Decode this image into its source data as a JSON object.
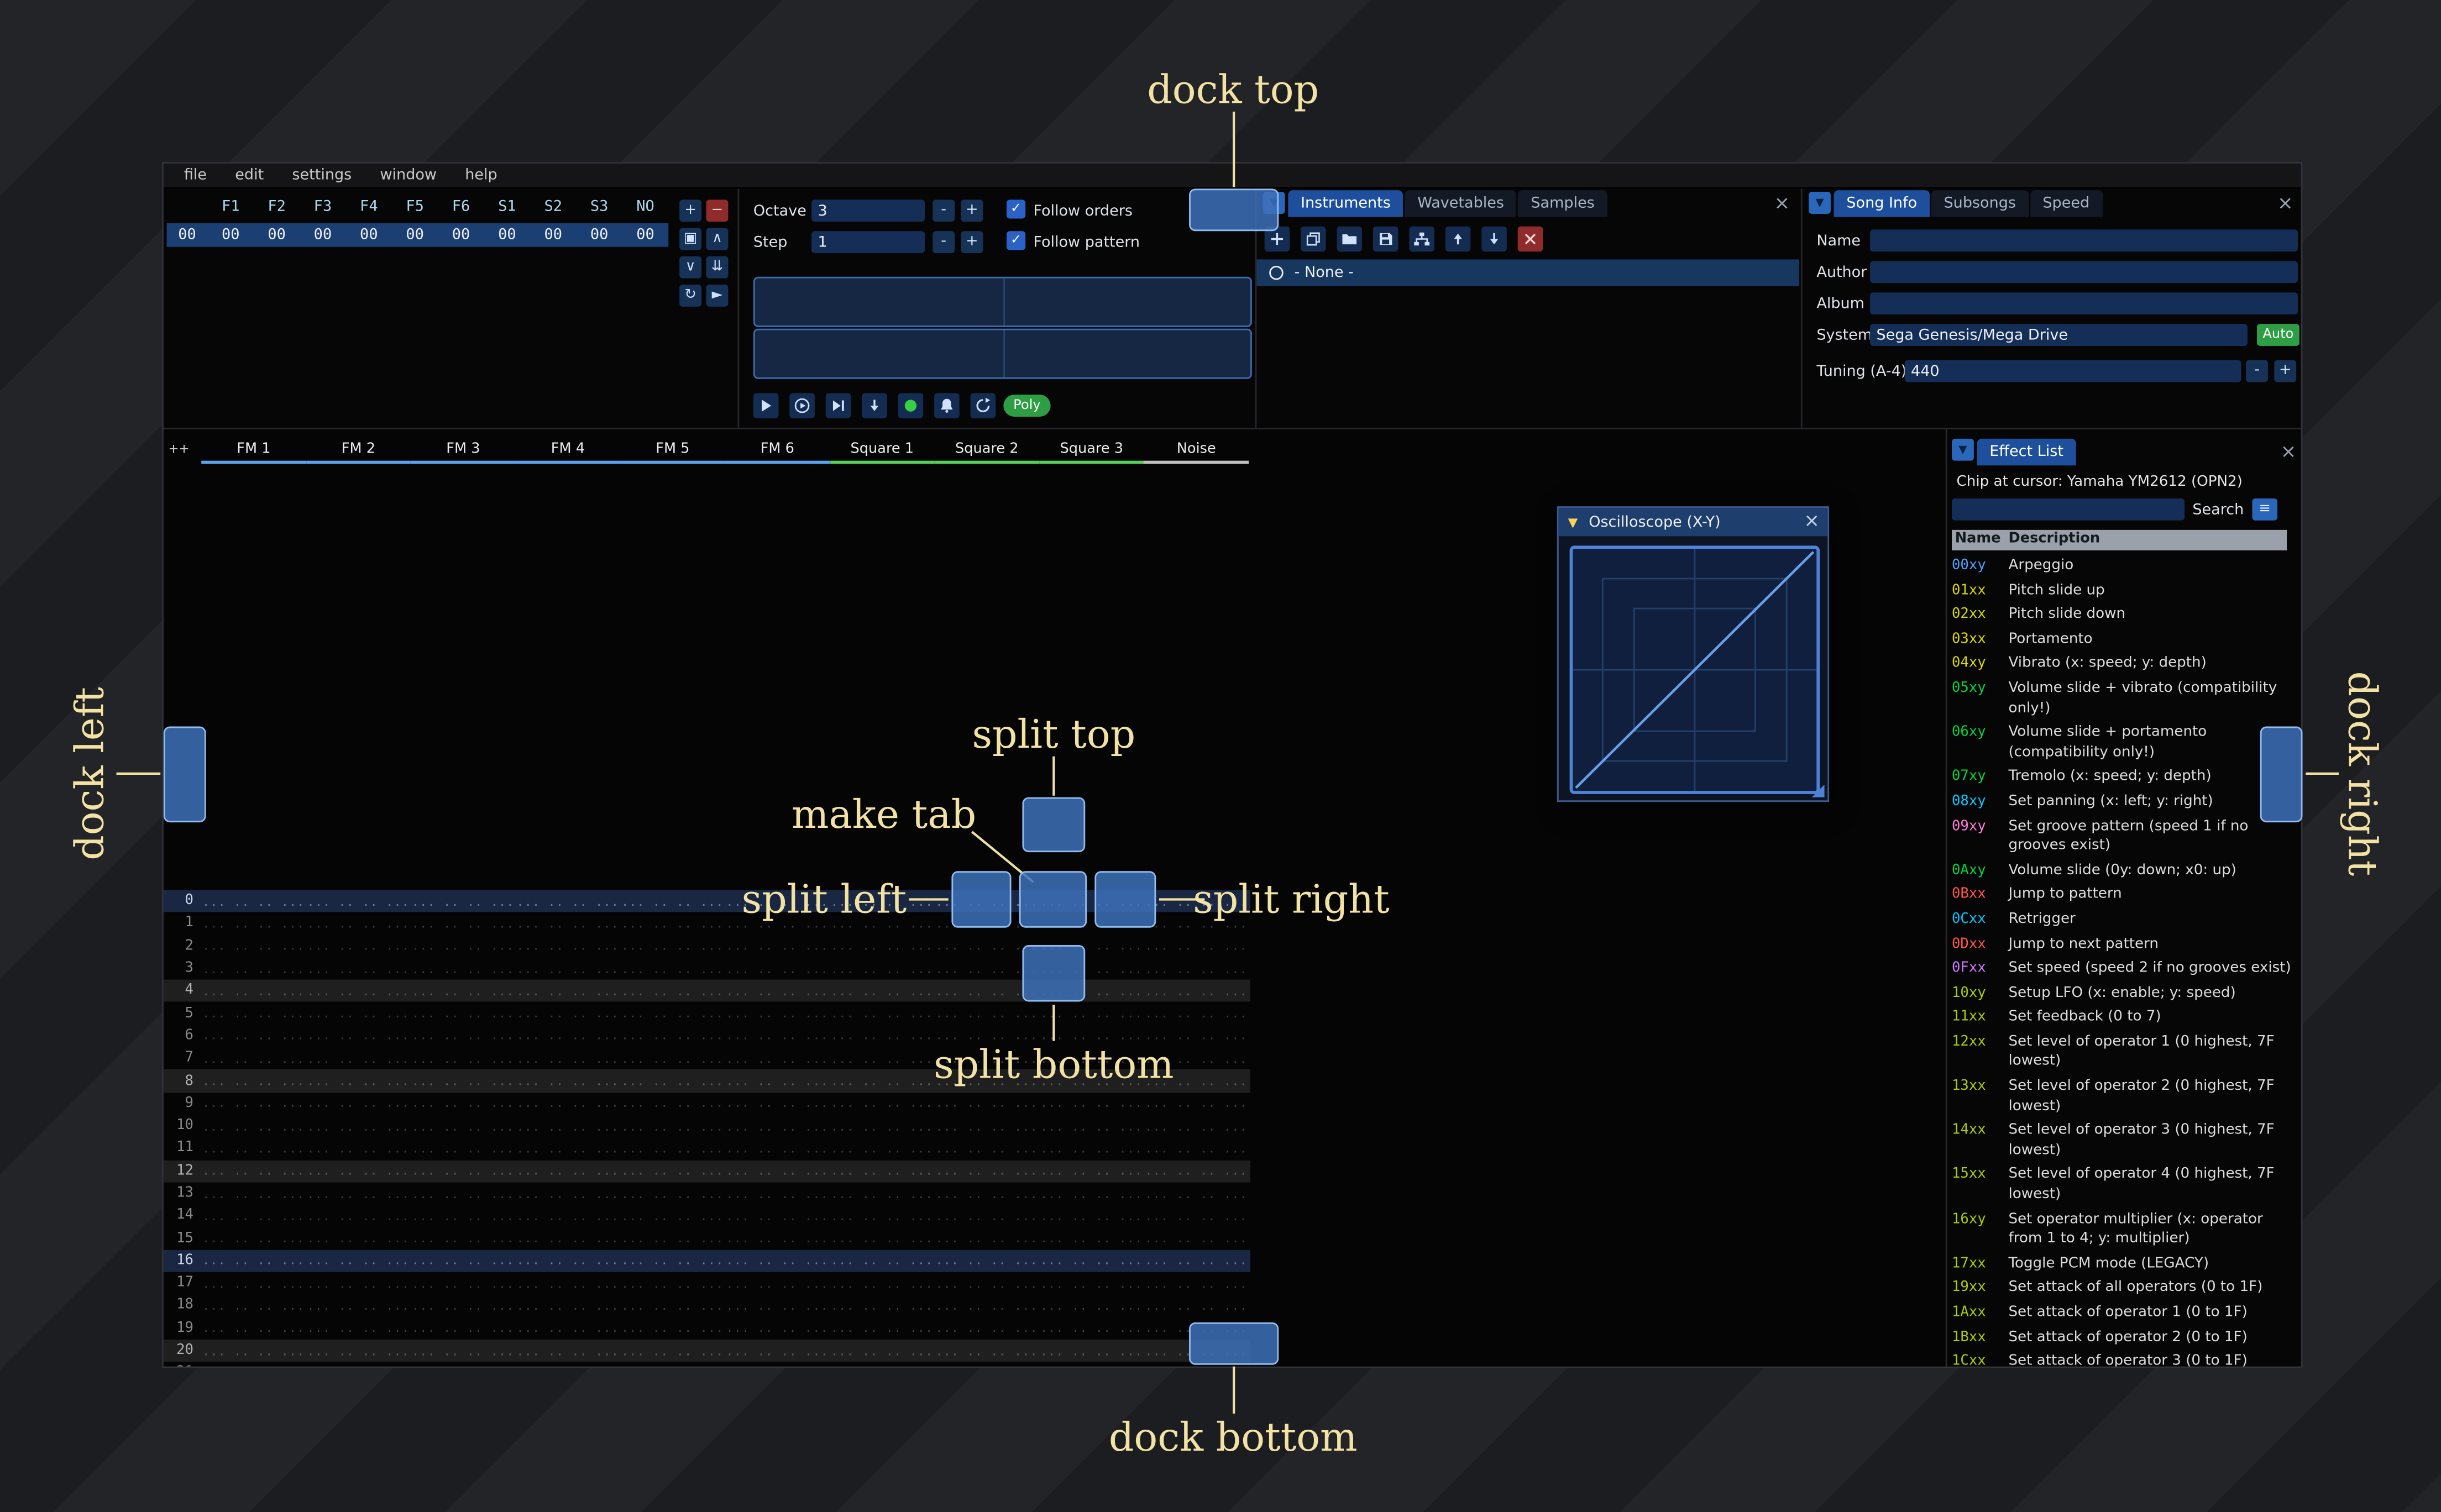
{
  "ui": {
    "collapse_glyph": "▼",
    "close_glyph": "×",
    "check_glyph": "✓"
  },
  "window": {
    "menu": [
      "file",
      "edit",
      "settings",
      "window",
      "help"
    ]
  },
  "orders": {
    "row_index": "00",
    "channel_headers": [
      "F1",
      "F2",
      "F3",
      "F4",
      "F5",
      "F6",
      "S1",
      "S2",
      "S3",
      "NO"
    ],
    "row_values": [
      "00",
      "00",
      "00",
      "00",
      "00",
      "00",
      "00",
      "00",
      "00",
      "00"
    ],
    "buttons": [
      {
        "name": "order-add-button",
        "glyph": "+",
        "style": "normal"
      },
      {
        "name": "order-remove-button",
        "glyph": "−",
        "style": "danger"
      },
      {
        "name": "order-duplicate-button",
        "glyph": "▣",
        "style": "normal"
      },
      {
        "name": "order-move-up-button",
        "glyph": "∧",
        "style": "normal"
      },
      {
        "name": "order-move-down-button",
        "glyph": "∨",
        "style": "normal"
      },
      {
        "name": "order-duplicate-end-button",
        "glyph": "⇊",
        "style": "normal"
      },
      {
        "name": "order-change-mode-button",
        "glyph": "↻",
        "style": "normal"
      },
      {
        "name": "order-edit-mode-button",
        "glyph": "►",
        "style": "normal"
      }
    ]
  },
  "playback": {
    "octave_label": "Octave",
    "octave_value": "3",
    "step_label": "Step",
    "step_value": "1",
    "minus_label": "-",
    "plus_label": "+",
    "follow_orders_label": "Follow orders",
    "follow_pattern_label": "Follow pattern",
    "poly_label": "Poly",
    "transport": [
      {
        "name": "play-button",
        "icon": "play"
      },
      {
        "name": "play-pattern-button",
        "icon": "play-circle"
      },
      {
        "name": "play-from-cursor-button",
        "icon": "play-to-cursor"
      },
      {
        "name": "step-one-row-button",
        "icon": "arrow-down"
      },
      {
        "name": "record-button",
        "icon": "record"
      },
      {
        "name": "metronome-button",
        "icon": "bell"
      },
      {
        "name": "repeat-pattern-button",
        "icon": "repeat"
      }
    ]
  },
  "instruments": {
    "tabs": [
      {
        "label": "Instruments",
        "active": true
      },
      {
        "label": "Wavetables",
        "active": false
      },
      {
        "label": "Samples",
        "active": false
      }
    ],
    "toolbar": [
      {
        "name": "instrument-add-button",
        "icon": "plus",
        "style": "normal"
      },
      {
        "name": "instrument-duplicate-button",
        "icon": "duplicate",
        "style": "normal"
      },
      {
        "name": "instrument-open-button",
        "icon": "folder-open",
        "style": "normal"
      },
      {
        "name": "instrument-save-button",
        "icon": "save",
        "style": "normal"
      },
      {
        "name": "instrument-organize-button",
        "icon": "sitemap",
        "style": "normal"
      },
      {
        "name": "instrument-move-up-button",
        "icon": "arrow-up",
        "style": "normal"
      },
      {
        "name": "instrument-move-down-button",
        "icon": "arrow-down",
        "style": "normal"
      },
      {
        "name": "instrument-delete-button",
        "icon": "delete",
        "style": "danger"
      }
    ],
    "list": [
      {
        "label": "- None -",
        "selected": true
      }
    ]
  },
  "song_info": {
    "tabs": [
      {
        "label": "Song Info",
        "active": true
      },
      {
        "label": "Subsongs",
        "active": false
      },
      {
        "label": "Speed",
        "active": false
      }
    ],
    "name_label": "Name",
    "name_value": "",
    "author_label": "Author",
    "author_value": "",
    "album_label": "Album",
    "album_value": "",
    "system_label": "System",
    "system_value": "Sega Genesis/Mega Drive",
    "auto_label": "Auto",
    "tuning_label": "Tuning (A-4)",
    "tuning_value": "440"
  },
  "pattern": {
    "corner_label": "++",
    "channels": [
      {
        "name": "FM 1",
        "color": "#5aa2f0"
      },
      {
        "name": "FM 2",
        "color": "#5aa2f0"
      },
      {
        "name": "FM 3",
        "color": "#5aa2f0"
      },
      {
        "name": "FM 4",
        "color": "#5aa2f0"
      },
      {
        "name": "FM 5",
        "color": "#5aa2f0"
      },
      {
        "name": "FM 6",
        "color": "#5aa2f0"
      },
      {
        "name": "Square 1",
        "color": "#58d058"
      },
      {
        "name": "Square 2",
        "color": "#58d058"
      },
      {
        "name": "Square 3",
        "color": "#58d058"
      },
      {
        "name": "Noise",
        "color": "#c0c0c0"
      }
    ],
    "row_count": 22,
    "empty_cell": "... .. .. ...",
    "minor_highlight_every": 4,
    "major_highlight_every": 16
  },
  "oscilloscope": {
    "title": "Oscilloscope (X-Y)"
  },
  "effect_list": {
    "tab_label": "Effect List",
    "chip_line": "Chip at cursor: Yamaha YM2612 (OPN2)",
    "search_label": "Search",
    "menu_glyph": "≡",
    "columns": [
      "Name",
      "Description"
    ],
    "effects": [
      {
        "code": "00xy",
        "color": "#4ba0ff",
        "lines": [
          "Arpeggio"
        ]
      },
      {
        "code": "01xx",
        "color": "#d8d800",
        "lines": [
          "Pitch slide up"
        ]
      },
      {
        "code": "02xx",
        "color": "#d8d800",
        "lines": [
          "Pitch slide down"
        ]
      },
      {
        "code": "03xx",
        "color": "#d8d800",
        "lines": [
          "Portamento"
        ]
      },
      {
        "code": "04xy",
        "color": "#d8d800",
        "lines": [
          "Vibrato (x: speed; y: depth)"
        ]
      },
      {
        "code": "05xy",
        "color": "#00d43c",
        "lines": [
          "Volume slide + vibrato (compatibility",
          "only!)"
        ]
      },
      {
        "code": "06xy",
        "color": "#00d43c",
        "lines": [
          "Volume slide + portamento",
          "(compatibility only!)"
        ]
      },
      {
        "code": "07xy",
        "color": "#00d43c",
        "lines": [
          "Tremolo (x: speed; y: depth)"
        ]
      },
      {
        "code": "08xy",
        "color": "#00c8ff",
        "lines": [
          "Set panning (x: left; y: right)"
        ]
      },
      {
        "code": "09xy",
        "color": "#ff7ad4",
        "lines": [
          "Set groove pattern (speed 1 if no",
          "grooves exist)"
        ]
      },
      {
        "code": "0Axy",
        "color": "#00d43c",
        "lines": [
          "Volume slide (0y: down; x0: up)"
        ]
      },
      {
        "code": "0Bxx",
        "color": "#ff5547",
        "lines": [
          "Jump to pattern"
        ]
      },
      {
        "code": "0Cxx",
        "color": "#00c8ff",
        "lines": [
          "Retrigger"
        ]
      },
      {
        "code": "0Dxx",
        "color": "#ff5547",
        "lines": [
          "Jump to next pattern"
        ]
      },
      {
        "code": "0Fxx",
        "color": "#cc78ff",
        "lines": [
          "Set speed (speed 2 if no grooves exist)"
        ]
      },
      {
        "code": "10xy",
        "color": "#aacc00",
        "lines": [
          "Setup LFO (x: enable; y: speed)"
        ]
      },
      {
        "code": "11xx",
        "color": "#aacc00",
        "lines": [
          "Set feedback (0 to 7)"
        ]
      },
      {
        "code": "12xx",
        "color": "#aacc00",
        "lines": [
          "Set level of operator 1 (0 highest, 7F",
          "lowest)"
        ]
      },
      {
        "code": "13xx",
        "color": "#aacc00",
        "lines": [
          "Set level of operator 2 (0 highest, 7F",
          "lowest)"
        ]
      },
      {
        "code": "14xx",
        "color": "#aacc00",
        "lines": [
          "Set level of operator 3 (0 highest, 7F",
          "lowest)"
        ]
      },
      {
        "code": "15xx",
        "color": "#aacc00",
        "lines": [
          "Set level of operator 4 (0 highest, 7F",
          "lowest)"
        ]
      },
      {
        "code": "16xy",
        "color": "#aacc00",
        "lines": [
          "Set operator multiplier (x: operator",
          "from 1 to 4; y: multiplier)"
        ]
      },
      {
        "code": "17xx",
        "color": "#aacc00",
        "lines": [
          "Toggle PCM mode (LEGACY)"
        ]
      },
      {
        "code": "19xx",
        "color": "#aacc00",
        "lines": [
          "Set attack of all operators (0 to 1F)"
        ]
      },
      {
        "code": "1Axx",
        "color": "#aacc00",
        "lines": [
          "Set attack of operator 1 (0 to 1F)"
        ]
      },
      {
        "code": "1Bxx",
        "color": "#aacc00",
        "lines": [
          "Set attack of operator 2 (0 to 1F)"
        ]
      },
      {
        "code": "1Cxx",
        "color": "#aacc00",
        "lines": [
          "Set attack of operator 3 (0 to 1F)"
        ]
      }
    ]
  },
  "overlay": {
    "dock_top": "dock top",
    "dock_bottom": "dock bottom",
    "dock_left": "dock left",
    "dock_right": "dock right",
    "split_top": "split top",
    "split_bottom": "split bottom",
    "split_left": "split left",
    "split_right": "split right",
    "make_tab": "make tab",
    "accent_color": "#f2e2a4"
  }
}
